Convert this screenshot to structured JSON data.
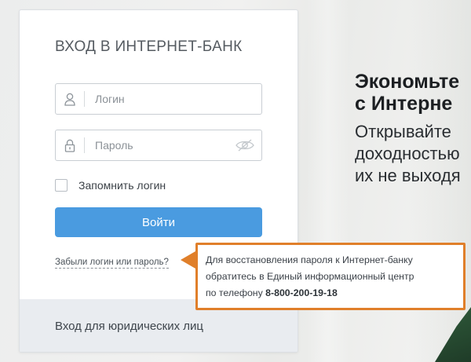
{
  "login_card": {
    "title": "ВХОД В ИНТЕРНЕТ-БАНК",
    "login_placeholder": "Логин",
    "password_placeholder": "Пароль",
    "remember_label": "Запомнить логин",
    "submit_label": "Войти",
    "forgot_link": "Забыли логин или пароль?",
    "legal_link": "Вход для юридических лиц"
  },
  "tooltip": {
    "line1": "Для восстановления пароля к Интернет-банку",
    "line2": "обратитесь в Единый информационный центр",
    "line3_prefix": "по телефону ",
    "phone": "8-800-200-19-18"
  },
  "promo": {
    "headline_line1": "Экономьте",
    "headline_line2": "с Интерне",
    "text_line1": "Открывайте",
    "text_line2": "доходностью",
    "text_line3": "их не выходя"
  },
  "colors": {
    "button": "#4a9be0",
    "tooltip_border": "#e07f2a",
    "footer_bg": "#e9ecf0"
  },
  "icons": {
    "login_field": "user-icon",
    "password_field": "lock-icon",
    "password_toggle": "eye-off-icon"
  }
}
